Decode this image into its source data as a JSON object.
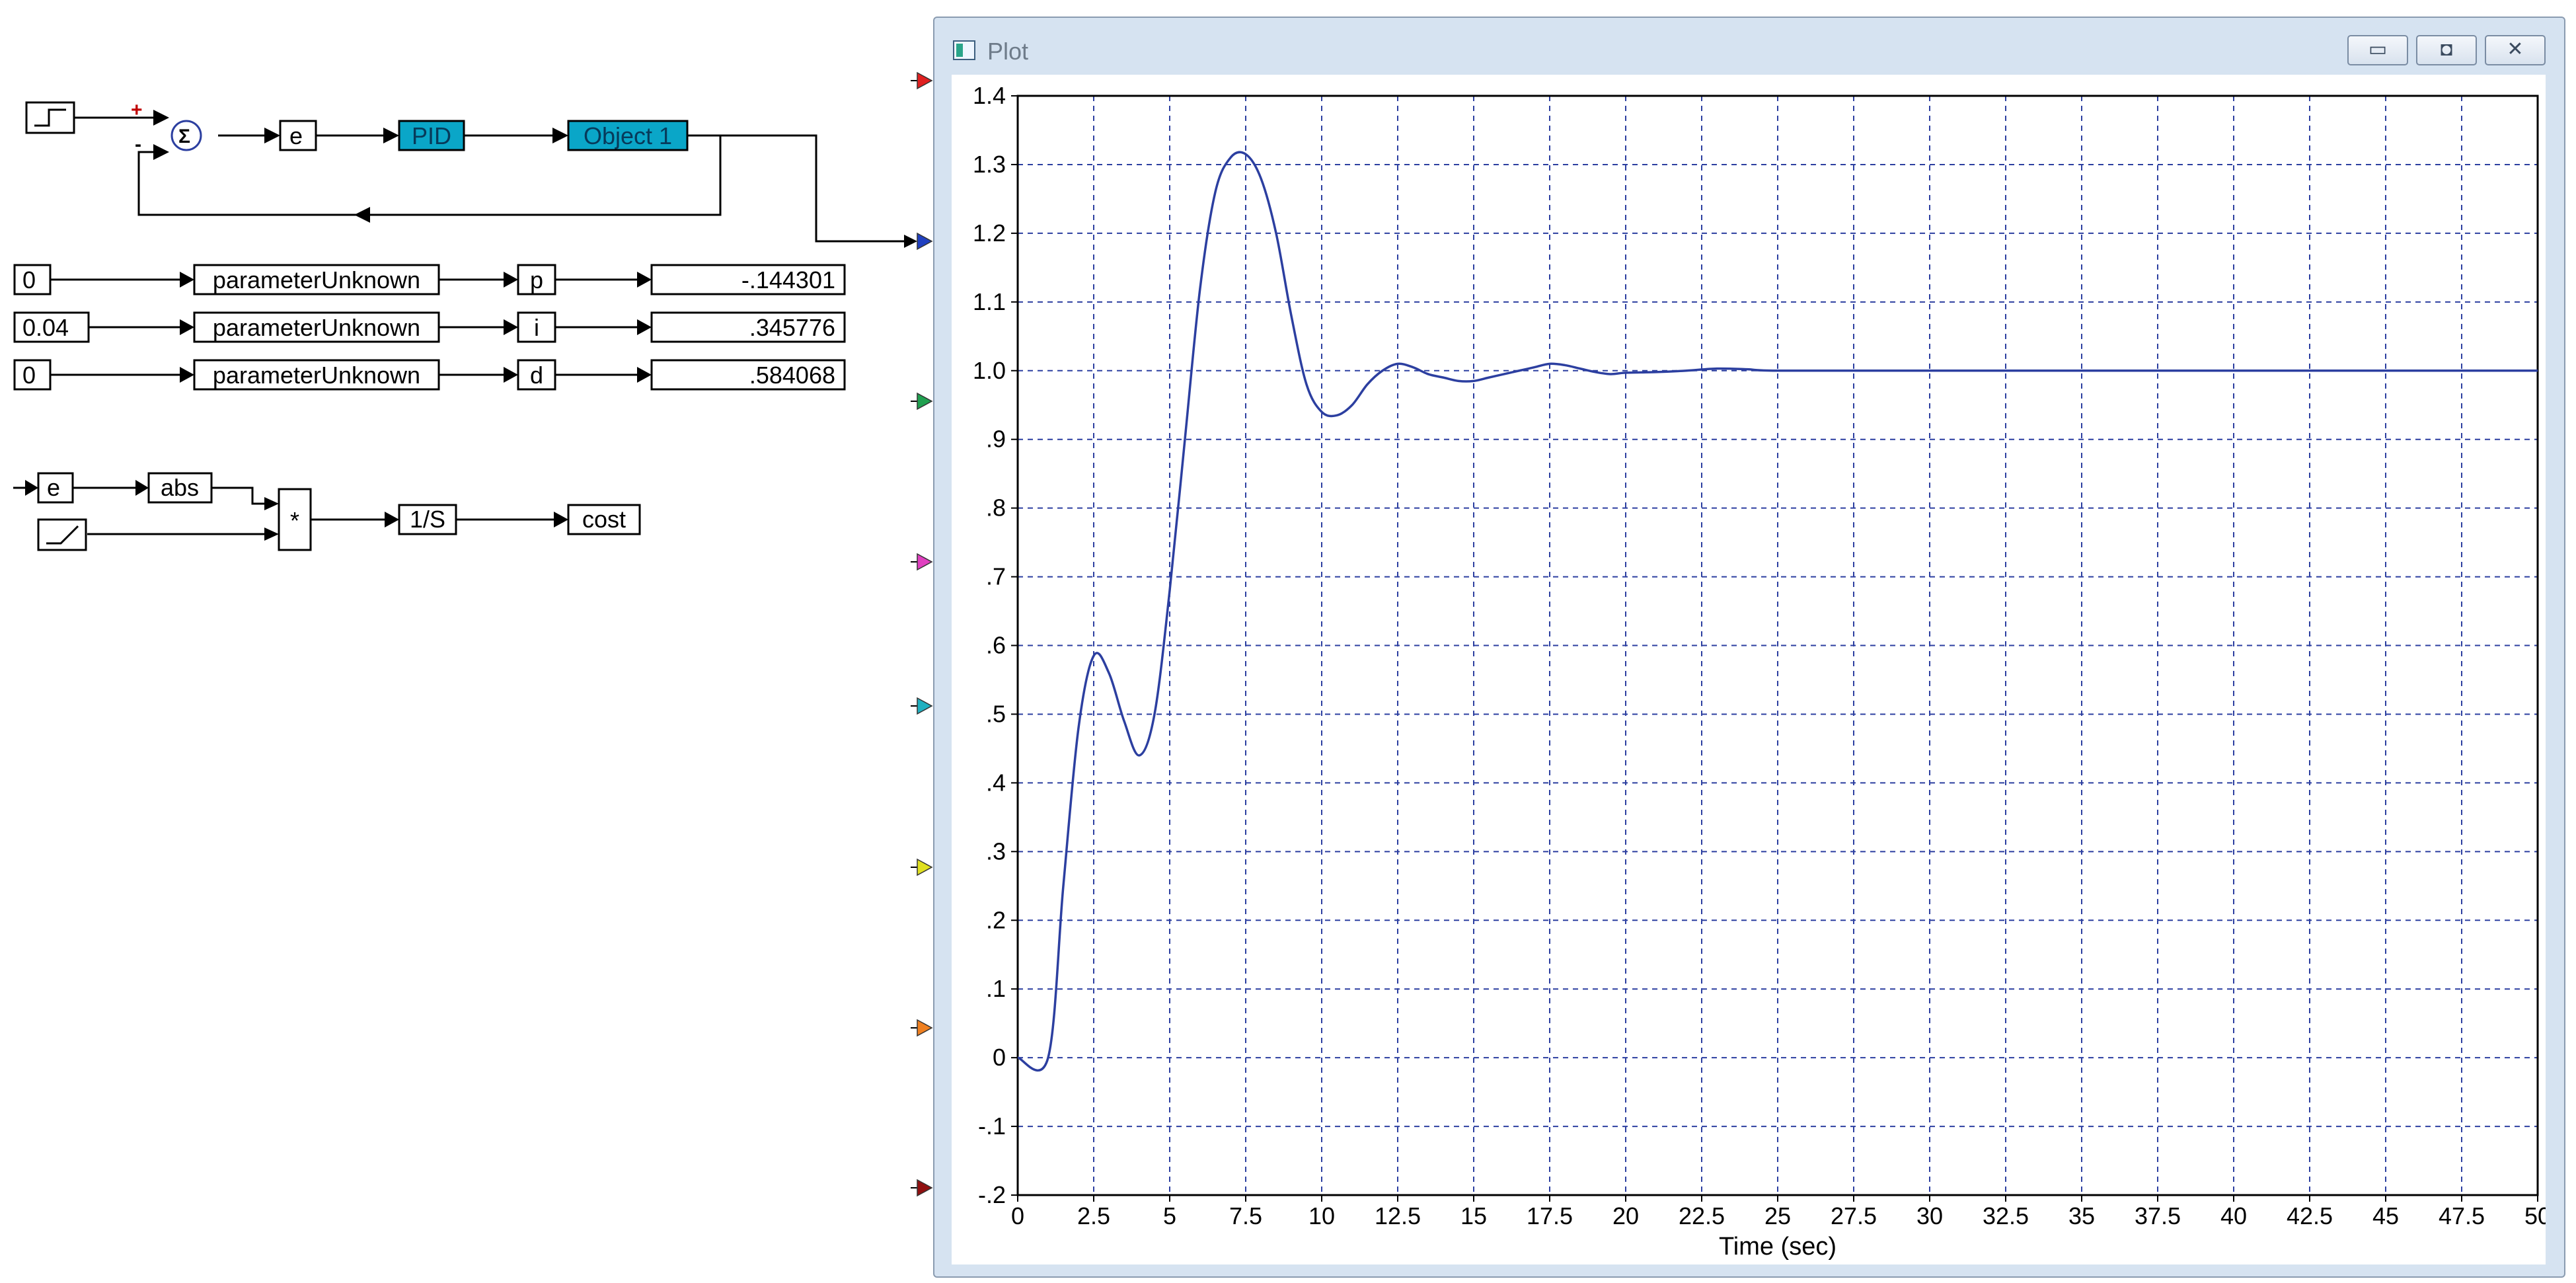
{
  "diagram": {
    "sum_plus": "+",
    "sum_minus": "-",
    "sum_symbol": "Σ",
    "error_label": "e",
    "pid_label": "PID",
    "object_label": "Object 1",
    "params": [
      {
        "const": "0",
        "func": "parameterUnknown",
        "name": "p",
        "display": "-.144301"
      },
      {
        "const": "0.04",
        "func": "parameterUnknown",
        "name": "i",
        "display": ".345776"
      },
      {
        "const": "0",
        "func": "parameterUnknown",
        "name": "d",
        "display": ".584068"
      }
    ],
    "cost_error_label": "e",
    "abs_label": "abs",
    "mult_label": "*",
    "integrator_label": "1/S",
    "cost_label": "cost",
    "input_markers": [
      {
        "color": "#e02020"
      },
      {
        "color": "#2040c0"
      },
      {
        "color": "#20a050"
      },
      {
        "color": "#e040c0"
      },
      {
        "color": "#20b0c0"
      },
      {
        "color": "#e0e020"
      },
      {
        "color": "#f08020"
      },
      {
        "color": "#901010"
      }
    ]
  },
  "window": {
    "title": "Plot",
    "min_symbol": "▭",
    "max_symbol": "◘",
    "close_symbol": "✕"
  },
  "chart_data": {
    "type": "line",
    "xlabel": "Time (sec)",
    "ylabel": "",
    "xlim": [
      0,
      50
    ],
    "ylim": [
      -0.2,
      1.4
    ],
    "grid": true,
    "x_ticks": [
      "0",
      "2.5",
      "5",
      "7.5",
      "10",
      "12.5",
      "15",
      "17.5",
      "20",
      "22.5",
      "25",
      "27.5",
      "30",
      "32.5",
      "35",
      "37.5",
      "40",
      "42.5",
      "45",
      "47.5",
      "50"
    ],
    "y_ticks": [
      "1.4",
      "1.3",
      "1.2",
      "1.1",
      "1.0",
      ".9",
      ".8",
      ".7",
      ".6",
      ".5",
      ".4",
      ".3",
      ".2",
      ".1",
      "0",
      "-.1",
      "-.2"
    ],
    "series": [
      {
        "color": "#2c3fa0",
        "x": [
          0,
          1,
          1.5,
          2,
          2.5,
          3,
          3.5,
          4,
          4.5,
          5,
          5.5,
          6,
          6.5,
          7,
          7.5,
          8,
          8.5,
          9,
          9.5,
          10,
          10.5,
          11,
          11.5,
          12,
          12.5,
          13,
          13.5,
          14,
          14.5,
          15,
          15.5,
          16,
          16.5,
          17,
          17.5,
          18,
          18.5,
          19,
          19.5,
          20,
          21,
          22,
          23,
          24,
          25,
          30,
          40,
          50
        ],
        "y": [
          0,
          0,
          0.25,
          0.48,
          0.585,
          0.56,
          0.49,
          0.44,
          0.5,
          0.68,
          0.9,
          1.12,
          1.26,
          1.31,
          1.315,
          1.28,
          1.2,
          1.08,
          0.98,
          0.94,
          0.935,
          0.95,
          0.98,
          1.0,
          1.01,
          1.005,
          0.995,
          0.99,
          0.985,
          0.985,
          0.99,
          0.995,
          1.0,
          1.005,
          1.01,
          1.008,
          1.003,
          0.998,
          0.995,
          0.997,
          0.998,
          1.0,
          1.003,
          1.002,
          1.0,
          1.0,
          1.0,
          1.0
        ]
      }
    ]
  }
}
